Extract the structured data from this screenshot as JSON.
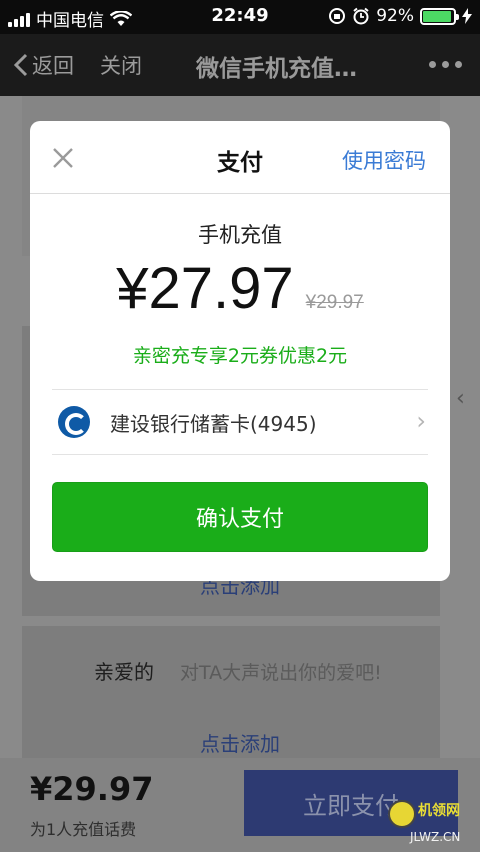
{
  "status_bar": {
    "carrier": "中国电信",
    "time": "22:49",
    "battery": "92%",
    "battery_level": 0.92
  },
  "nav": {
    "back_label": "返回",
    "close_label": "关闭",
    "title": "微信手机充值…"
  },
  "background": {
    "add_label": "点击添加",
    "add_label_2": "点击添加",
    "recipient_label": "亲爱的",
    "message_hint": "对TA大声说出你的爱吧!",
    "total_price": "¥29.97",
    "total_note": "为1人充值话费",
    "pay_now_label": "立即支付",
    "watermark_text": "机领网",
    "watermark_url": "JLWZ.CN"
  },
  "dialog": {
    "title": "支付",
    "use_password": "使用密码",
    "item_name": "手机充值",
    "amount": "¥27.97",
    "original_price": "¥29.97",
    "promo_text": "亲密充专享2元券优惠2元",
    "card_name": "建设银行储蓄卡(4945)",
    "confirm_label": "确认支付"
  },
  "colors": {
    "accent_green": "#1aad19",
    "link_blue": "#3a7bd5",
    "bank_blue": "#0f5aa6"
  }
}
